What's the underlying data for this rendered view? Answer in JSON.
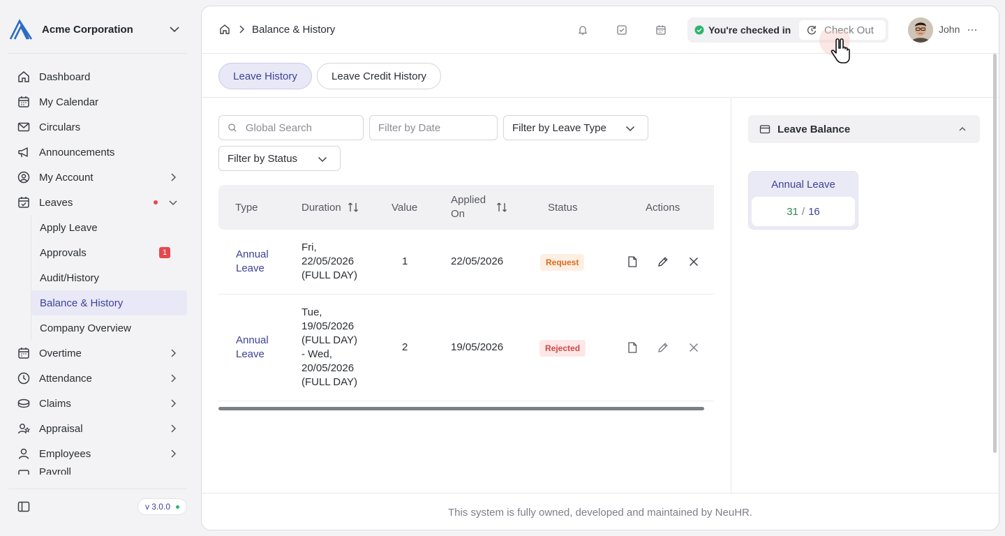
{
  "org": {
    "name": "Acme Corporation"
  },
  "nav": {
    "items": [
      {
        "label": "Dashboard",
        "icon": "home-icon"
      },
      {
        "label": "My Calendar",
        "icon": "calendar-icon"
      },
      {
        "label": "Circulars",
        "icon": "mail-icon"
      },
      {
        "label": "Announcements",
        "icon": "megaphone-icon"
      },
      {
        "label": "My Account",
        "icon": "user-circle-icon"
      },
      {
        "label": "Leaves",
        "icon": "calendar-check-icon"
      }
    ],
    "leaves_sub": [
      {
        "label": "Apply Leave"
      },
      {
        "label": "Approvals",
        "badge": "1"
      },
      {
        "label": "Audit/History"
      },
      {
        "label": "Balance & History"
      },
      {
        "label": "Company Overview"
      }
    ],
    "items_after": [
      {
        "label": "Overtime",
        "icon": "calendar-icon"
      },
      {
        "label": "Attendance",
        "icon": "clock-icon"
      },
      {
        "label": "Claims",
        "icon": "coins-icon"
      },
      {
        "label": "Appraisal",
        "icon": "user-star-icon"
      },
      {
        "label": "Employees",
        "icon": "user-icon"
      },
      {
        "label": "Payroll",
        "icon": "wallet-icon"
      }
    ],
    "version": "v 3.0.0"
  },
  "topbar": {
    "breadcrumb": "Balance & History",
    "checkin_status": "You're checked in",
    "checkout_label": "Check Out",
    "user_name": "John"
  },
  "tabs": [
    {
      "label": "Leave History",
      "active": true
    },
    {
      "label": "Leave Credit History",
      "active": false
    }
  ],
  "filters": {
    "search_placeholder": "Global Search",
    "date_placeholder": "Filter by Date",
    "leave_type_label": "Filter by Leave Type",
    "status_label": "Filter by Status"
  },
  "table": {
    "headers": [
      "Type",
      "Duration",
      "Value",
      "Applied On",
      "Status",
      "Actions"
    ],
    "rows": [
      {
        "type": "Annual Leave",
        "duration": [
          "Fri,",
          "22/05/2026",
          "(FULL DAY)"
        ],
        "value": "1",
        "applied_on": "22/05/2026",
        "status": "Request"
      },
      {
        "type": "Annual Leave",
        "duration": [
          "Tue,",
          "19/05/2026",
          "(FULL DAY)",
          "- Wed,",
          "20/05/2026",
          "(FULL DAY)"
        ],
        "value": "2",
        "applied_on": "19/05/2026",
        "status": "Rejected"
      }
    ]
  },
  "leave_balance": {
    "title": "Leave Balance",
    "cards": [
      {
        "label": "Annual Leave",
        "used": "31",
        "separator": "/",
        "total": "16"
      }
    ]
  },
  "footer": {
    "text": "This system is fully owned, developed and maintained by NeuHR."
  },
  "colors": {
    "accent": "#3c4296",
    "active_bg": "#e8e8f6",
    "request": "#d96b1d",
    "rejected": "#d04848",
    "success": "#2db56b"
  }
}
